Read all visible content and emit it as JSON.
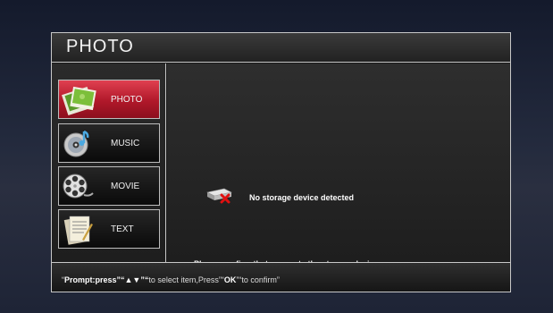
{
  "header": {
    "title": "PHOTO"
  },
  "menu": {
    "items": [
      {
        "label": "PHOTO",
        "icon": "photo-icon",
        "active": true
      },
      {
        "label": "MUSIC",
        "icon": "music-disc-icon",
        "active": false
      },
      {
        "label": "MOVIE",
        "icon": "film-reel-icon",
        "active": false
      },
      {
        "label": "TEXT",
        "icon": "document-icon",
        "active": false
      }
    ]
  },
  "content": {
    "status": "No storage device detected",
    "status_icon": "storage-missing-icon",
    "prompt": "Please confirm that connects the storage device"
  },
  "footer": {
    "hint_open": "“",
    "hint_prompt": "Prompt:press",
    "hint_arrows": "”“▲▼”“",
    "hint_mid": "to select item,Press”“",
    "hint_ok": "OK",
    "hint_end": "”“to confirm”"
  },
  "colors": {
    "active_item": "#c21a2e",
    "border": "#c8c8c8"
  }
}
